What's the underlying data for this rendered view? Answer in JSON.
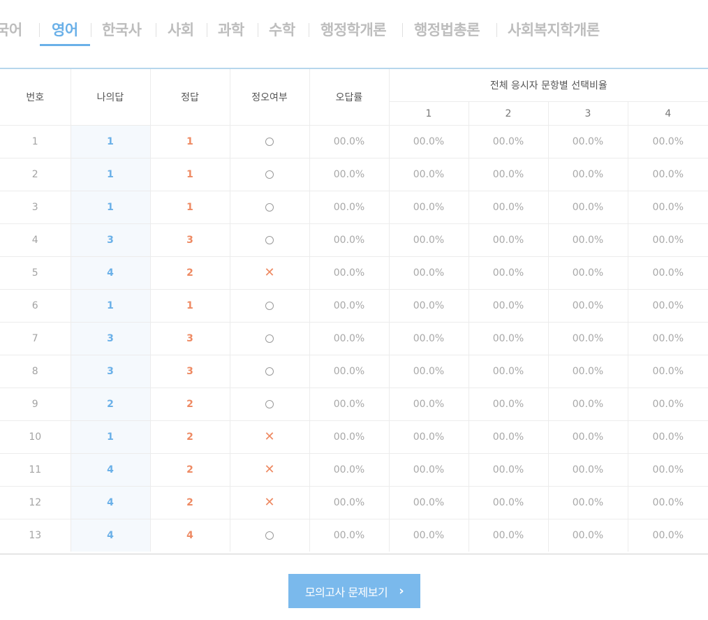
{
  "tabs": [
    {
      "label": "국어",
      "active": false
    },
    {
      "label": "영어",
      "active": true
    },
    {
      "label": "한국사",
      "active": false
    },
    {
      "label": "사회",
      "active": false
    },
    {
      "label": "과학",
      "active": false
    },
    {
      "label": "수학",
      "active": false
    },
    {
      "label": "행정학개론",
      "active": false
    },
    {
      "label": "행정법총론",
      "active": false
    },
    {
      "label": "사회복지학개론",
      "active": false
    }
  ],
  "table": {
    "headers": {
      "number": "번호",
      "my_answer": "나의답",
      "correct": "정답",
      "result": "정오여부",
      "error_rate": "오답률",
      "distribution": "전체 응시자 문항별 선택비율",
      "choices": [
        "1",
        "2",
        "3",
        "4"
      ]
    },
    "rows": [
      {
        "no": "1",
        "mine": "1",
        "answer": "1",
        "result": "O",
        "rate": "00.0%",
        "c1": "00.0%",
        "c2": "00.0%",
        "c3": "00.0%",
        "c4": "00.0%"
      },
      {
        "no": "2",
        "mine": "1",
        "answer": "1",
        "result": "O",
        "rate": "00.0%",
        "c1": "00.0%",
        "c2": "00.0%",
        "c3": "00.0%",
        "c4": "00.0%"
      },
      {
        "no": "3",
        "mine": "1",
        "answer": "1",
        "result": "O",
        "rate": "00.0%",
        "c1": "00.0%",
        "c2": "00.0%",
        "c3": "00.0%",
        "c4": "00.0%"
      },
      {
        "no": "4",
        "mine": "3",
        "answer": "3",
        "result": "O",
        "rate": "00.0%",
        "c1": "00.0%",
        "c2": "00.0%",
        "c3": "00.0%",
        "c4": "00.0%"
      },
      {
        "no": "5",
        "mine": "4",
        "answer": "2",
        "result": "X",
        "rate": "00.0%",
        "c1": "00.0%",
        "c2": "00.0%",
        "c3": "00.0%",
        "c4": "00.0%"
      },
      {
        "no": "6",
        "mine": "1",
        "answer": "1",
        "result": "O",
        "rate": "00.0%",
        "c1": "00.0%",
        "c2": "00.0%",
        "c3": "00.0%",
        "c4": "00.0%"
      },
      {
        "no": "7",
        "mine": "3",
        "answer": "3",
        "result": "O",
        "rate": "00.0%",
        "c1": "00.0%",
        "c2": "00.0%",
        "c3": "00.0%",
        "c4": "00.0%"
      },
      {
        "no": "8",
        "mine": "3",
        "answer": "3",
        "result": "O",
        "rate": "00.0%",
        "c1": "00.0%",
        "c2": "00.0%",
        "c3": "00.0%",
        "c4": "00.0%"
      },
      {
        "no": "9",
        "mine": "2",
        "answer": "2",
        "result": "O",
        "rate": "00.0%",
        "c1": "00.0%",
        "c2": "00.0%",
        "c3": "00.0%",
        "c4": "00.0%"
      },
      {
        "no": "10",
        "mine": "1",
        "answer": "2",
        "result": "X",
        "rate": "00.0%",
        "c1": "00.0%",
        "c2": "00.0%",
        "c3": "00.0%",
        "c4": "00.0%"
      },
      {
        "no": "11",
        "mine": "4",
        "answer": "2",
        "result": "X",
        "rate": "00.0%",
        "c1": "00.0%",
        "c2": "00.0%",
        "c3": "00.0%",
        "c4": "00.0%"
      },
      {
        "no": "12",
        "mine": "4",
        "answer": "2",
        "result": "X",
        "rate": "00.0%",
        "c1": "00.0%",
        "c2": "00.0%",
        "c3": "00.0%",
        "c4": "00.0%"
      },
      {
        "no": "13",
        "mine": "4",
        "answer": "4",
        "result": "O",
        "rate": "00.0%",
        "c1": "00.0%",
        "c2": "00.0%",
        "c3": "00.0%",
        "c4": "00.0%"
      }
    ]
  },
  "button": {
    "label": "모의고사 문제보기",
    "icon": "chevron-right-icon"
  },
  "colors": {
    "accent": "#6ab0e8",
    "answer": "#ee8a63",
    "button_bg": "#7ab9ec"
  }
}
